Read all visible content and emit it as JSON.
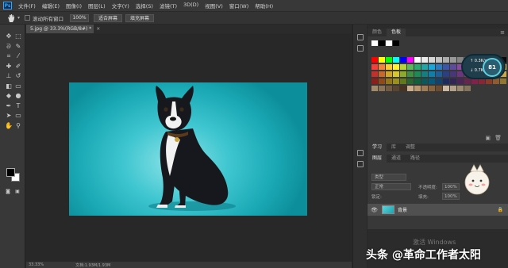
{
  "menubar": {
    "logo": "Ps",
    "items": [
      "文件(F)",
      "编辑(E)",
      "图像(I)",
      "图层(L)",
      "文字(Y)",
      "选择(S)",
      "滤镜(T)",
      "3D(D)",
      "视图(V)",
      "窗口(W)",
      "帮助(H)"
    ]
  },
  "options": {
    "scroll_all_label": "滚动所有窗口",
    "zoom_value": "100%",
    "fit_screen_label": "适合屏幕",
    "fill_screen_label": "填充屏幕"
  },
  "document": {
    "tab_title": "5.jpg @ 33.3%(RGB/8#)",
    "tab_modified": "*",
    "tab_close": "×",
    "zoom_status": "33.33%",
    "doc_status": "文档:1.93M/1.93M"
  },
  "tools": [
    {
      "name": "move-tool",
      "glyph": "✥"
    },
    {
      "name": "marquee-tool",
      "glyph": "⬚"
    },
    {
      "name": "lasso-tool",
      "glyph": "ᘐ"
    },
    {
      "name": "quick-select-tool",
      "glyph": "✎"
    },
    {
      "name": "crop-tool",
      "glyph": "⌗"
    },
    {
      "name": "eyedropper-tool",
      "glyph": "⁄"
    },
    {
      "name": "healing-tool",
      "glyph": "✚"
    },
    {
      "name": "brush-tool",
      "glyph": "✐"
    },
    {
      "name": "stamp-tool",
      "glyph": "⊥"
    },
    {
      "name": "history-brush-tool",
      "glyph": "↺"
    },
    {
      "name": "eraser-tool",
      "glyph": "◧"
    },
    {
      "name": "gradient-tool",
      "glyph": "▭"
    },
    {
      "name": "blur-tool",
      "glyph": "◆"
    },
    {
      "name": "dodge-tool",
      "glyph": "●"
    },
    {
      "name": "pen-tool",
      "glyph": "✒"
    },
    {
      "name": "type-tool",
      "glyph": "T"
    },
    {
      "name": "path-select-tool",
      "glyph": "➤"
    },
    {
      "name": "shape-tool",
      "glyph": "▭"
    },
    {
      "name": "hand-tool",
      "glyph": "✋"
    },
    {
      "name": "zoom-tool",
      "glyph": "⚲"
    }
  ],
  "colors": {
    "foreground": "#000000",
    "background": "#ffffff",
    "canvas_bg": "#282828",
    "ui_panel": "#383838",
    "photo_accent": "#3fc6d0"
  },
  "color_panel": {
    "tabs": [
      "颜色",
      "色板"
    ],
    "active_tab": "色板",
    "menu_icon": "≡"
  },
  "swatch_rows": [
    [
      "#ff0000",
      "#ffff00",
      "#00ff00",
      "#00ffff",
      "#0000ff",
      "#ff00ff",
      "#ffffff",
      "#ebebeb",
      "#d6d6d6",
      "#c2c2c2",
      "#adadad",
      "#999999",
      "#858585",
      "#707070",
      "#5c5c5c",
      "#474747",
      "#333333",
      "#1f1f1f",
      "#0a0a0a"
    ],
    [
      "#f0413d",
      "#f5843a",
      "#fcca34",
      "#fff22e",
      "#b5d33a",
      "#5cb85c",
      "#2eaa6f",
      "#1fa7a8",
      "#1aa6d9",
      "#2b7bc4",
      "#3d55a6",
      "#5e4a9e",
      "#8a4a9e",
      "#b5478e",
      "#e0438a",
      "#ee4466",
      "#f26c4f",
      "#f7a35c",
      "#fdd15e"
    ],
    [
      "#c4302b",
      "#c9682a",
      "#cfa52a",
      "#d4c82a",
      "#8eaa2e",
      "#3f8f43",
      "#1f8a58",
      "#127f81",
      "#117eaa",
      "#1c5f9a",
      "#2c3f82",
      "#47367c",
      "#6b367c",
      "#903570",
      "#b3336b",
      "#bf3550",
      "#c2553d",
      "#c88246",
      "#cda84b"
    ],
    [
      "#8c1f1a",
      "#91491a",
      "#96761a",
      "#9a901a",
      "#62781f",
      "#29652e",
      "#135f3c",
      "#0a595a",
      "#095878",
      "#12426d",
      "#1e2b5d",
      "#322558",
      "#4c2558",
      "#66244f",
      "#80234b",
      "#882537",
      "#8a3b29",
      "#8e5c30",
      "#917734"
    ],
    [
      "#a28a6a",
      "#8c7355",
      "#735b41",
      "#5c452f",
      "#47331f",
      "#ccae8a",
      "#b8966e",
      "#a07c55",
      "#876340",
      "#6e4d2e",
      "#c9b9a5",
      "#b3a18a",
      "#9c8a72",
      "#85735c"
    ]
  ],
  "overlay_dial": {
    "value": "81",
    "up_speed": "↑ 0.3K/s",
    "down_speed": "↓ 0.7K/s"
  },
  "layers_panel": {
    "tabs": [
      "学习",
      "库",
      "调整"
    ],
    "sub_tabs": [
      "图层",
      "通道",
      "路径"
    ],
    "search_placeholder": "类型",
    "blend_mode": "正常",
    "opacity_label": "不透明度:",
    "opacity_value": "100%",
    "lock_label": "锁定:",
    "fill_label": "填充:",
    "fill_value": "100%",
    "layer_name": "背景",
    "lock_icon": "🔒",
    "eye_icon": "👁"
  },
  "watermark": {
    "activate": "激活 Windows",
    "credit": "头条 @革命工作者太阳"
  }
}
